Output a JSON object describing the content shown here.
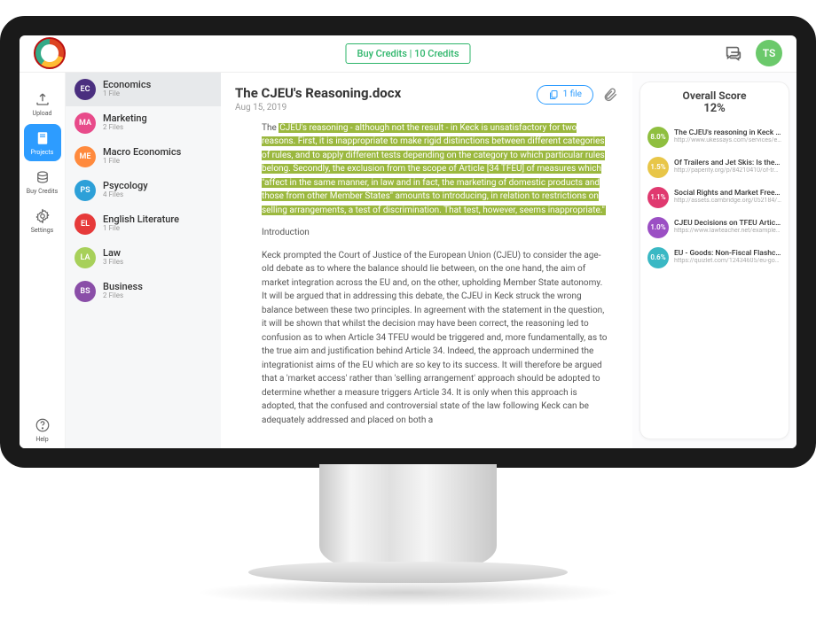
{
  "header": {
    "credits_label": "Buy Credits | 10 Credits",
    "user_initials": "TS"
  },
  "leftnav": {
    "items": [
      {
        "icon": "upload",
        "label": "Upload"
      },
      {
        "icon": "projects",
        "label": "Projects"
      },
      {
        "icon": "credits",
        "label": "Buy Credits"
      },
      {
        "icon": "settings",
        "label": "Settings"
      }
    ],
    "help_label": "Help"
  },
  "projects": [
    {
      "badge": "EC",
      "color": "#4a2f7f",
      "name": "Economics",
      "sub": "1 File"
    },
    {
      "badge": "MA",
      "color": "#e84b8a",
      "name": "Marketing",
      "sub": "2 Files"
    },
    {
      "badge": "ME",
      "color": "#ff8a3d",
      "name": "Macro Economics",
      "sub": "1 File"
    },
    {
      "badge": "PS",
      "color": "#2da0d8",
      "name": "Psycology",
      "sub": "4 Files"
    },
    {
      "badge": "EL",
      "color": "#e63a3a",
      "name": "English Literature",
      "sub": "1 File"
    },
    {
      "badge": "LA",
      "color": "#a7d05a",
      "name": "Law",
      "sub": "3 Files"
    },
    {
      "badge": "BS",
      "color": "#8a4ea8",
      "name": "Business",
      "sub": "2 Files"
    }
  ],
  "document": {
    "title": "The CJEU's Reasoning.docx",
    "date": "Aug 15, 2019",
    "file_chip": "1 file",
    "lead_in": "The ",
    "highlighted": "CJEU's reasoning - although not the result - in Keck is unsatisfactory for two reasons. First, it is inappropriate to make rigid distinctions between different categories of rules, and to apply different tests depending on the category to which particular rules belong. Secondly, the exclusion from the scope of Article [34 TFEU] of measures which \"affect in the same manner, in law and in fact, the marketing of domestic products and those from other Member States\" amounts to introducing, in relation to restrictions on selling arrangements, a test of discrimination. That test, however, seems inappropriate.\"",
    "section_heading": "Introduction",
    "body": "Keck prompted the Court of Justice of the European Union (CJEU) to consider the age-old debate as to where the balance should lie between, on the one hand, the aim of market integration across the EU and, on the other, upholding Member State autonomy. It will be argued that in addressing this debate, the CJEU in Keck struck the wrong balance between these two principles. In agreement with the statement in the question, it will be shown that whilst the decision may have been correct, the reasoning led to confusion as to when Article 34 TFEU would be triggered and, more fundamentally, as to the true aim and justification behind Article 34. Indeed, the approach undermined the integrationist aims of the EU which are so key to its success. It will therefore be argued that a 'market access' rather than 'selling arrangement' approach should be adopted to determine whether a measure triggers Article 34. It is only when this approach is adopted, that the confused and controversial state of the law following Keck can be adequately addressed and placed on both a"
  },
  "score": {
    "title": "Overall Score",
    "value": "12%",
    "matches": [
      {
        "pct": "8.0%",
        "color": "#8fbf3f",
        "title": "The CJEU's reasoning in Keck is ...",
        "url": "http://www.ukessays.com/services/examples..."
      },
      {
        "pct": "1.5%",
        "color": "#e8c648",
        "title": "Of Trailers and Jet Skis: Is the Ca...",
        "url": "http://paperity.org/p/84210410/of-trailers-..."
      },
      {
        "pct": "1.1%",
        "color": "#e0396f",
        "title": "Social Rights and Market Freedo...",
        "url": "http://assets.cambridge.org/052184/1267/fr..."
      },
      {
        "pct": "1.0%",
        "color": "#9b4fc4",
        "title": "CJEU Decisions on TFEU Articl...",
        "url": "https://www.lawteacher.net/example-essay..."
      },
      {
        "pct": "0.6%",
        "color": "#3ab8c4",
        "title": "EU - Goods: Non-Fiscal Flashc...",
        "url": "https://quizlet.com/12434605/eu-goods-no..."
      }
    ]
  }
}
